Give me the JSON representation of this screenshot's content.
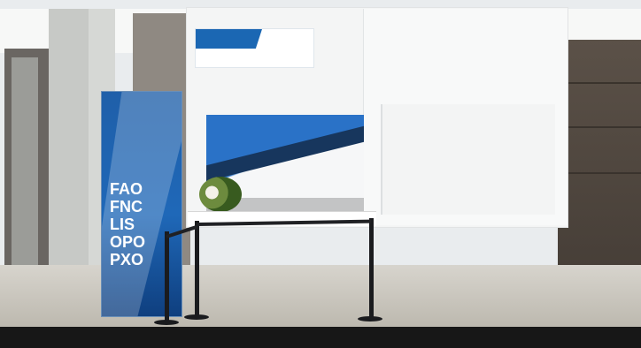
{
  "scene": {
    "banner_codes": [
      "FAO",
      "FNC",
      "LIS",
      "OPO",
      "PXO"
    ]
  }
}
